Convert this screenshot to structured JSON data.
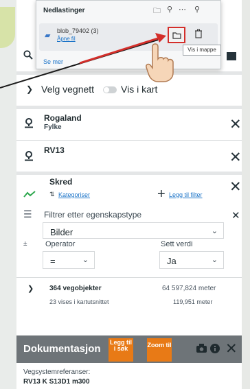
{
  "downloads": {
    "title": "Nedlastinger",
    "file_name": "blob_79402 (3)",
    "open_file": "Åpne fil",
    "see_more": "Se mer",
    "tooltip": "Vis i mappe"
  },
  "panel": {
    "road_selector": "Velg vegnett",
    "show_in_map": "Vis i kart",
    "filters": [
      {
        "title": "Rogaland",
        "subtitle": "Fylke"
      },
      {
        "title": "RV13",
        "subtitle": ""
      }
    ],
    "object_type": {
      "title": "Skred",
      "categorize": "Kategoriser",
      "add_filter": "Legg til filter"
    },
    "property_filter": {
      "label": "Filtrer etter egenskapstype",
      "property_value": "Bilder",
      "operator_label": "Operator",
      "operator_value": "=",
      "set_value_label": "Sett verdi",
      "set_value": "Ja"
    },
    "results": {
      "count": "364 vegobjekter",
      "length": "64 597,824 meter",
      "visible": "23 vises i kartutsnittet",
      "visible_length": "119,951 meter"
    }
  },
  "documentation": {
    "title": "Dokumentasjon",
    "add_to_search": "Legg til i søk",
    "zoom_to": "Zoom til"
  },
  "references": {
    "label": "Vegsystemreferanser:",
    "value": "RV13 K S13D1 m300"
  },
  "colors": {
    "accent_orange": "#e87a16",
    "link_blue": "#1a73c8",
    "trend_green": "#2fa84f",
    "highlight_red": "#d42e2a"
  }
}
